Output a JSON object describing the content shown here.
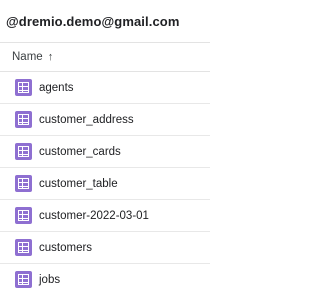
{
  "account": {
    "email": "@dremio.demo@gmail.com"
  },
  "list_header": {
    "name_label": "Name",
    "sort_arrow": "↑",
    "sort_direction": "ascending"
  },
  "files": [
    {
      "name": "agents",
      "icon": "sheet-icon"
    },
    {
      "name": "customer_address",
      "icon": "sheet-icon"
    },
    {
      "name": "customer_cards",
      "icon": "sheet-icon"
    },
    {
      "name": "customer_table",
      "icon": "sheet-icon"
    },
    {
      "name": "customer-2022-03-01",
      "icon": "sheet-icon"
    },
    {
      "name": "customers",
      "icon": "sheet-icon"
    },
    {
      "name": "jobs",
      "icon": "sheet-icon"
    }
  ],
  "colors": {
    "sheet_icon": "#8e6fd1",
    "sheet_icon_grid": "#ffffff"
  }
}
